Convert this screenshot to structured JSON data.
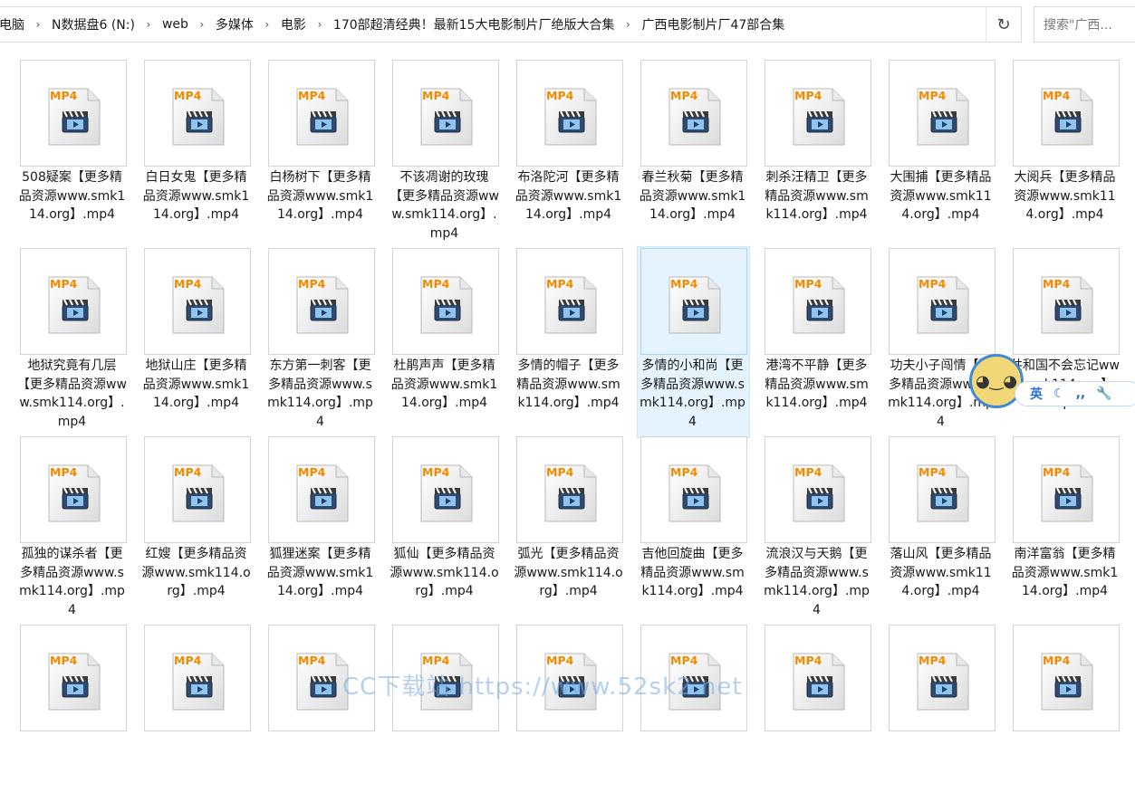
{
  "breadcrumb": [
    "电脑",
    "N数据盘6 (N:)",
    "web",
    "多媒体",
    "电影",
    "170部超清经典！最新15大电影制片厂绝版大合集",
    "广西电影制片厂47部合集"
  ],
  "search": {
    "placeholder": "搜索\"广西..."
  },
  "icons": {
    "separator": "chevron-right-icon",
    "dropdown": "chevron-down-icon",
    "refresh": "refresh-icon",
    "file": "mp4-file-icon"
  },
  "file_badge": "MP4",
  "files": [
    "508疑案【更多精品资源www.smk114.org】.mp4",
    "白日女鬼【更多精品资源www.smk114.org】.mp4",
    "白杨树下【更多精品资源www.smk114.org】.mp4",
    "不该凋谢的玫瑰【更多精品资源www.smk114.org】.mp4",
    "布洛陀河【更多精品资源www.smk114.org】.mp4",
    "春兰秋菊【更多精品资源www.smk114.org】.mp4",
    "刺杀汪精卫【更多精品资源www.smk114.org】.mp4",
    "大围捕【更多精品资源www.smk114.org】.mp4",
    "大阅兵【更多精品资源www.smk114.org】.mp4",
    "地狱究竟有几层【更多精品资源www.smk114.org】.mp4",
    "地狱山庄【更多精品资源www.smk114.org】.mp4",
    "东方第一刺客【更多精品资源www.smk114.org】.mp4",
    "杜鹃声声【更多精品资源www.smk114.org】.mp4",
    "多情的帽子【更多精品资源www.smk114.org】.mp4",
    "多情的小和尚【更多精品资源www.smk114.org】.mp4",
    "港湾不平静【更多精品资源www.smk114.org】.mp4",
    "功夫小子闯情【更多精品资源www.smk114.org】.mp4",
    "共和国不会忘记www.smk114.org】.mp4",
    "孤独的谋杀者【更多精品资源www.smk114.org】.mp4",
    "红嫂【更多精品资源www.smk114.org】.mp4",
    "狐狸迷案【更多精品资源www.smk114.org】.mp4",
    "狐仙【更多精品资源www.smk114.org】.mp4",
    "弧光【更多精品资源www.smk114.org】.mp4",
    "吉他回旋曲【更多精品资源www.smk114.org】.mp4",
    "流浪汉与天鹅【更多精品资源www.smk114.org】.mp4",
    "落山风【更多精品资源www.smk114.org】.mp4",
    "南洋富翁【更多精品资源www.smk114.org】.mp4",
    "",
    "",
    "",
    "",
    "",
    "",
    "",
    "",
    ""
  ],
  "selected_index": 14,
  "ime": {
    "lang": "英",
    "icons": [
      "moon-icon",
      "quote-icon",
      "wrench-icon"
    ]
  },
  "watermark": "CC下载站 https://www.52sk2.net"
}
